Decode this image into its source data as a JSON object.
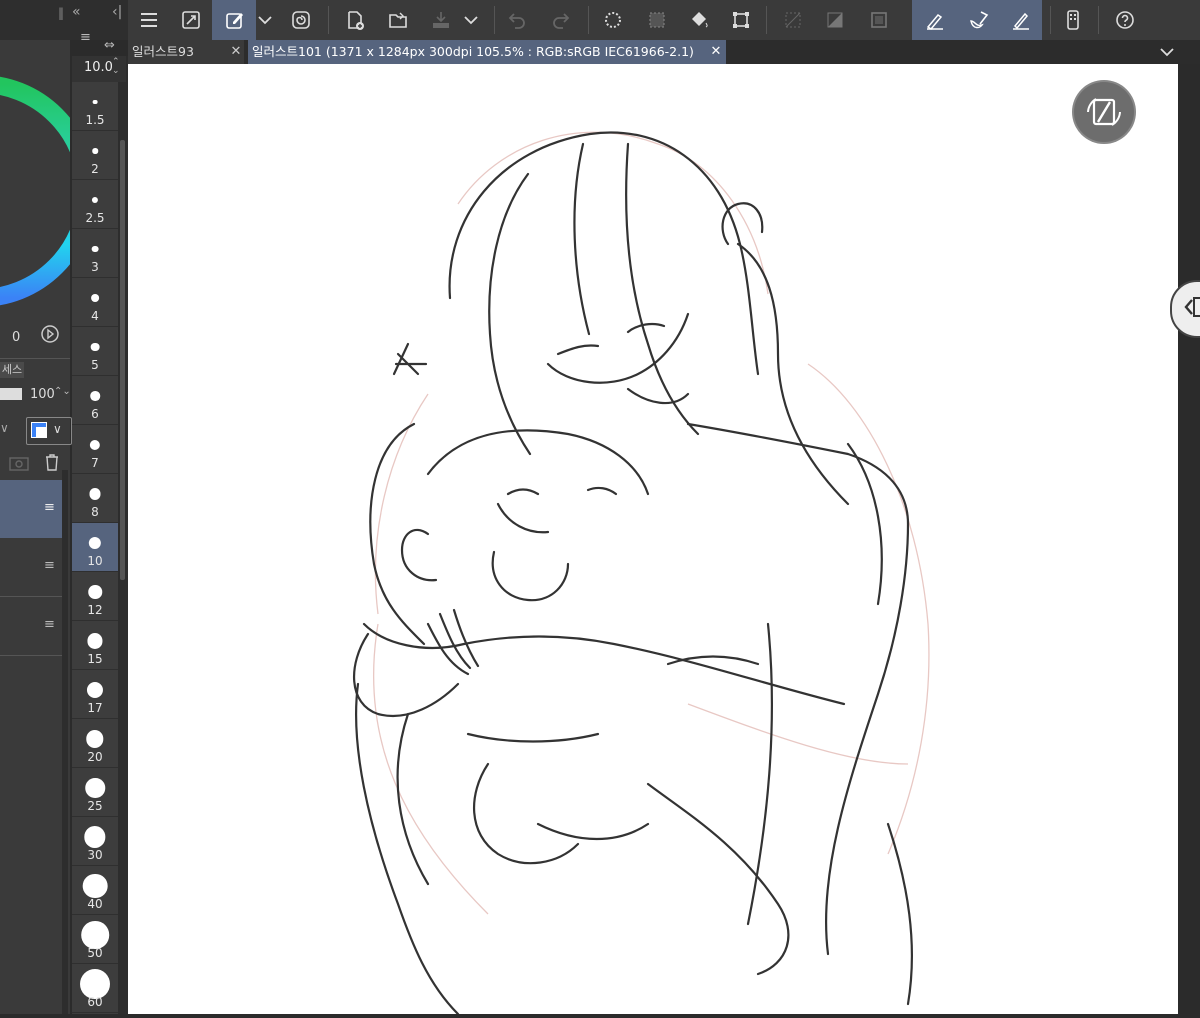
{
  "tabs": [
    {
      "label": "일러스트93",
      "active": false
    },
    {
      "label": "일러스트101 (1371 x 1284px 300dpi 105.5% : RGB:sRGB IEC61966-2.1)",
      "active": true
    }
  ],
  "brush_size": {
    "current": "10.0",
    "presets": [
      "1.5",
      "2",
      "2.5",
      "3",
      "4",
      "5",
      "6",
      "7",
      "8",
      "10",
      "12",
      "15",
      "17",
      "20",
      "25",
      "30",
      "40",
      "50",
      "60"
    ],
    "selected": "10"
  },
  "left_panel": {
    "hue_value": "0",
    "opacity_value": "100",
    "section_label": "세스"
  },
  "colors": {
    "accent": "#56647e",
    "toolbar_bg": "#3a3a3a",
    "panel_bg": "#3a3a3a"
  },
  "icons": {
    "menu": "hamburger-icon",
    "rotate_canvas": "rotate-reset-icon"
  }
}
